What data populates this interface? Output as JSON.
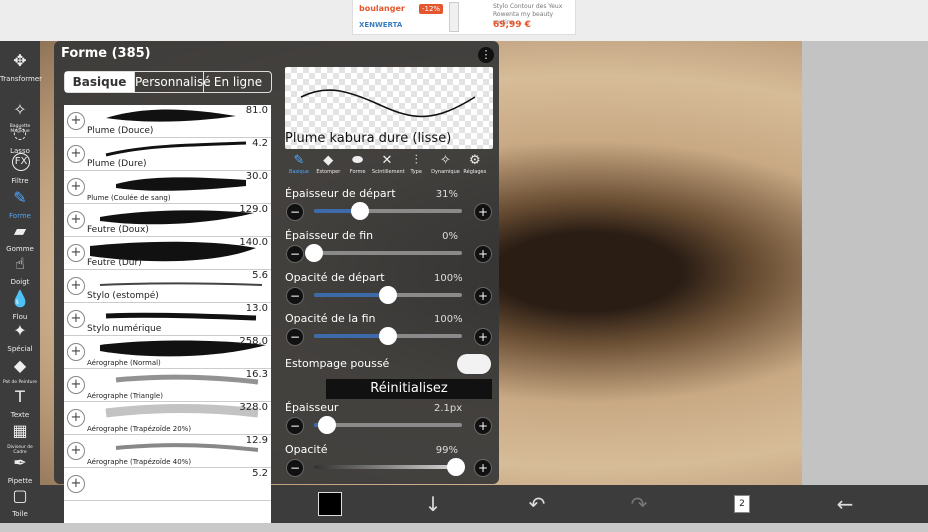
{
  "ad": {
    "brand": "boulanger",
    "brand2": "XENWERTA",
    "discount": "-12%",
    "description": "Stylo Contour des Yeux Rowenta my beauty routine ...",
    "price": "69,99 €"
  },
  "toolbar": {
    "tools": [
      {
        "label": "Transformer",
        "icon": "move-icon",
        "glyph": "✥"
      },
      {
        "label": "Baguette Magique",
        "icon": "magic-wand-icon",
        "glyph": "✧"
      },
      {
        "label": "Lasso",
        "icon": "lasso-icon",
        "glyph": "◌"
      },
      {
        "label": "Filtre",
        "icon": "fx-icon",
        "glyph": "FX"
      },
      {
        "label": "Forme",
        "icon": "brush-icon",
        "glyph": "✎"
      },
      {
        "label": "Gomme",
        "icon": "eraser-icon",
        "glyph": "▰"
      },
      {
        "label": "Doigt",
        "icon": "finger-icon",
        "glyph": "☝"
      },
      {
        "label": "Flou",
        "icon": "drop-icon",
        "glyph": "💧"
      },
      {
        "label": "Spécial",
        "icon": "special-icon",
        "glyph": "✦"
      },
      {
        "label": "Pot de Peinture",
        "icon": "bucket-icon",
        "glyph": "◆"
      },
      {
        "label": "Texte",
        "icon": "text-icon",
        "glyph": "T"
      },
      {
        "label": "Diviseur de Cadre",
        "icon": "frame-divider-icon",
        "glyph": "▦"
      },
      {
        "label": "Pipette",
        "icon": "eyedropper-icon",
        "glyph": "✒"
      },
      {
        "label": "Toile",
        "icon": "canvas-icon",
        "glyph": "▢"
      }
    ],
    "active_index": 4
  },
  "panel": {
    "title": "Forme (385)",
    "tabs": [
      "Basique",
      "Personnalisé",
      "En ligne"
    ],
    "selected_tab": 0,
    "brushes": [
      {
        "name": "Plume (Douce)",
        "value": "81.0",
        "small": false
      },
      {
        "name": "Plume (Dure)",
        "value": "4.2",
        "small": false
      },
      {
        "name": "Plume (Coulée de sang)",
        "value": "30.0",
        "small": true
      },
      {
        "name": "Feutre (Doux)",
        "value": "129.0",
        "small": false
      },
      {
        "name": "Feutre (Dur)",
        "value": "140.0",
        "small": false
      },
      {
        "name": "Stylo (estompé)",
        "value": "5.6",
        "small": false
      },
      {
        "name": "Stylo numérique",
        "value": "13.0",
        "small": false
      },
      {
        "name": "Aérographe (Normal)",
        "value": "258.0",
        "small": true
      },
      {
        "name": "Aérographe (Triangle)",
        "value": "16.3",
        "small": true
      },
      {
        "name": "Aérographe (Trapézoïde 20%)",
        "value": "328.0",
        "small": true
      },
      {
        "name": "Aérographe (Trapézoïde 40%)",
        "value": "12.9",
        "small": true
      },
      {
        "name": "",
        "value": "5.2",
        "small": true
      }
    ],
    "preview_name": "Plume kabura dure (lisse)",
    "settings_tabs": [
      {
        "label": "Basique",
        "glyph": "✎",
        "icon": "brush-icon"
      },
      {
        "label": "Estomper",
        "glyph": "◆",
        "icon": "blend-icon"
      },
      {
        "label": "Forme",
        "glyph": "⬬",
        "icon": "shape-icon"
      },
      {
        "label": "Scintillement",
        "glyph": "✕",
        "icon": "shuffle-icon"
      },
      {
        "label": "Type",
        "glyph": "⫶",
        "icon": "type-icon"
      },
      {
        "label": "Dynamique",
        "glyph": "✧",
        "icon": "dynamics-icon"
      },
      {
        "label": "Réglages",
        "glyph": "⚙",
        "icon": "gear-icon"
      }
    ],
    "selected_settings_tab": 0,
    "sliders": [
      {
        "label": "Épaisseur de départ",
        "value": "31%",
        "level": 0.31
      },
      {
        "label": "Épaisseur de fin",
        "value": "0%",
        "level": 0.0
      },
      {
        "label": "Opacité de départ",
        "value": "100%",
        "level": 0.5
      },
      {
        "label": "Opacité de la fin",
        "value": "100%",
        "level": 0.5
      }
    ],
    "toggle_label": "Estompage poussé",
    "reset_label": "Réinitialisez",
    "thickness": {
      "label": "Épaisseur",
      "value": "2.1px",
      "level": 0.09
    },
    "opacity": {
      "label": "Opacité",
      "value": "99%",
      "level": 0.96
    }
  },
  "bottombar": {
    "layer_count": "2"
  }
}
